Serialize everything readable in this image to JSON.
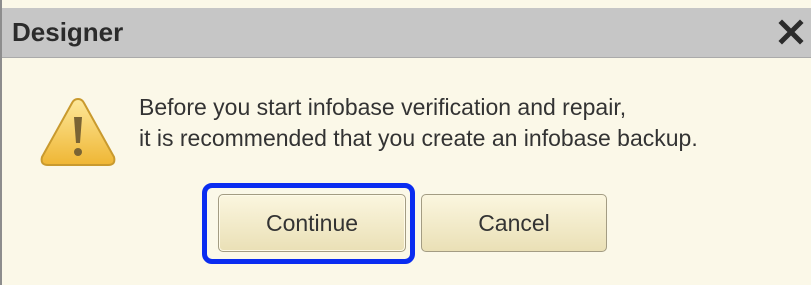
{
  "dialog": {
    "title": "Designer",
    "close_icon": "close-icon",
    "warning_icon": "warning-icon",
    "message_line1": "Before you start infobase verification and repair,",
    "message_line2": "it is recommended that you create an infobase backup.",
    "buttons": {
      "continue_label": "Continue",
      "cancel_label": "Cancel"
    }
  },
  "colors": {
    "titlebar": "#c6c6c6",
    "dialog_background": "#fbf8e8",
    "focus_ring": "#0a2cf0",
    "warning_fill": "#f5c443"
  }
}
